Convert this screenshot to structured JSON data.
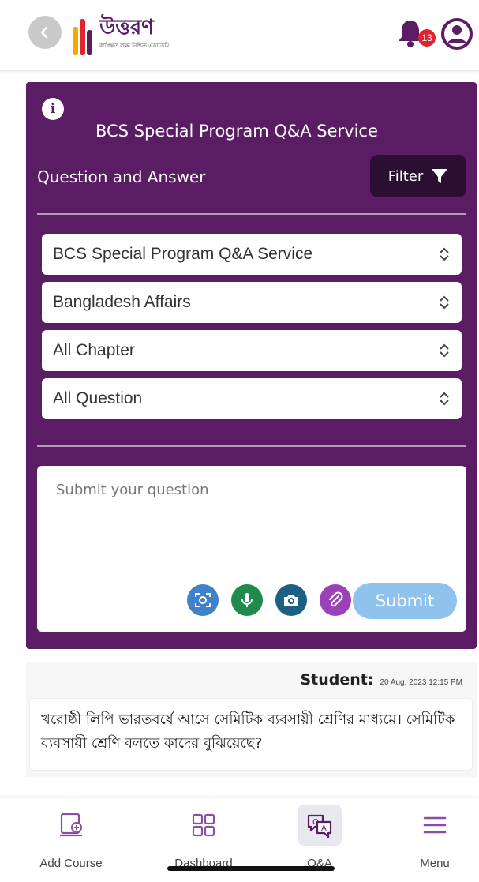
{
  "header": {
    "logo_text": "উত্তরণ",
    "logo_tagline": "কাঙ্ক্ষিত লক্ষ্য নিশ্চিত একাডেমি",
    "notification_count": "13",
    "icons": {
      "back": "back-arrow-icon",
      "bell": "bell-icon",
      "profile": "profile-icon"
    },
    "colors": {
      "brand": "#5a1d63",
      "badge": "#e0242e"
    }
  },
  "panel": {
    "info_icon": "i",
    "title": "BCS Special Program Q&A Service",
    "section_label": "Question and Answer",
    "filter_label": "Filter",
    "selects": [
      {
        "value": "BCS Special Program Q&A Service"
      },
      {
        "value": "Bangladesh Affairs"
      },
      {
        "value": "All Chapter"
      },
      {
        "value": "All Question"
      }
    ],
    "question_placeholder": "Submit your question",
    "tools": [
      "scan-icon",
      "microphone-icon",
      "camera-icon",
      "attachment-icon"
    ],
    "submit_label": "Submit"
  },
  "post": {
    "author": "Student:",
    "date": "20 Aug, 2023 12:15 PM",
    "body": "খরোষ্ঠী লিপি ভারতবর্ষে আসে সেমিটিক ব্যবসায়ী শ্রেণির মাধ্যমে। সেমিটিক ব্যবসায়ী শ্রেণি বলতে কাদের বুঝিয়েছে?"
  },
  "bottom_nav": {
    "items": [
      {
        "label": "Add Course",
        "icon": "add-course-icon"
      },
      {
        "label": "Dashboard",
        "icon": "dashboard-grid-icon"
      },
      {
        "label": "Q&A",
        "icon": "qa-icon",
        "active": true
      },
      {
        "label": "Menu",
        "icon": "menu-icon"
      }
    ]
  }
}
